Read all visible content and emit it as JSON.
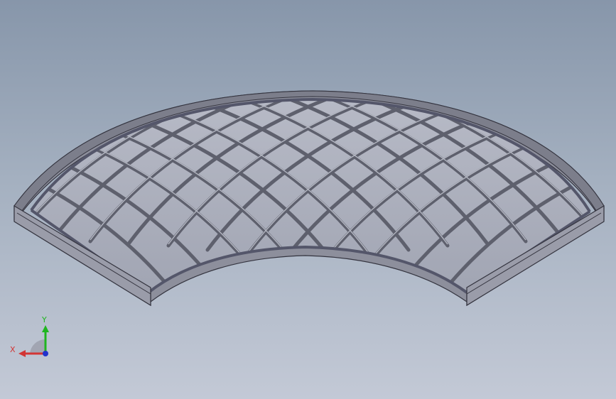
{
  "viewport": {
    "background_top": "#8796aa",
    "background_bottom": "#c3c9d6"
  },
  "model": {
    "description_icon": "curved-lattice-panel-model",
    "edge_color": "#3c3c48",
    "face_color": "#a9acbb",
    "frame_color": "#8c8e9c"
  },
  "triad": {
    "y_label": "Y",
    "x_label": "X",
    "y_color": "#1fb51f",
    "x_color": "#d23535",
    "origin_color": "#2233cc"
  }
}
